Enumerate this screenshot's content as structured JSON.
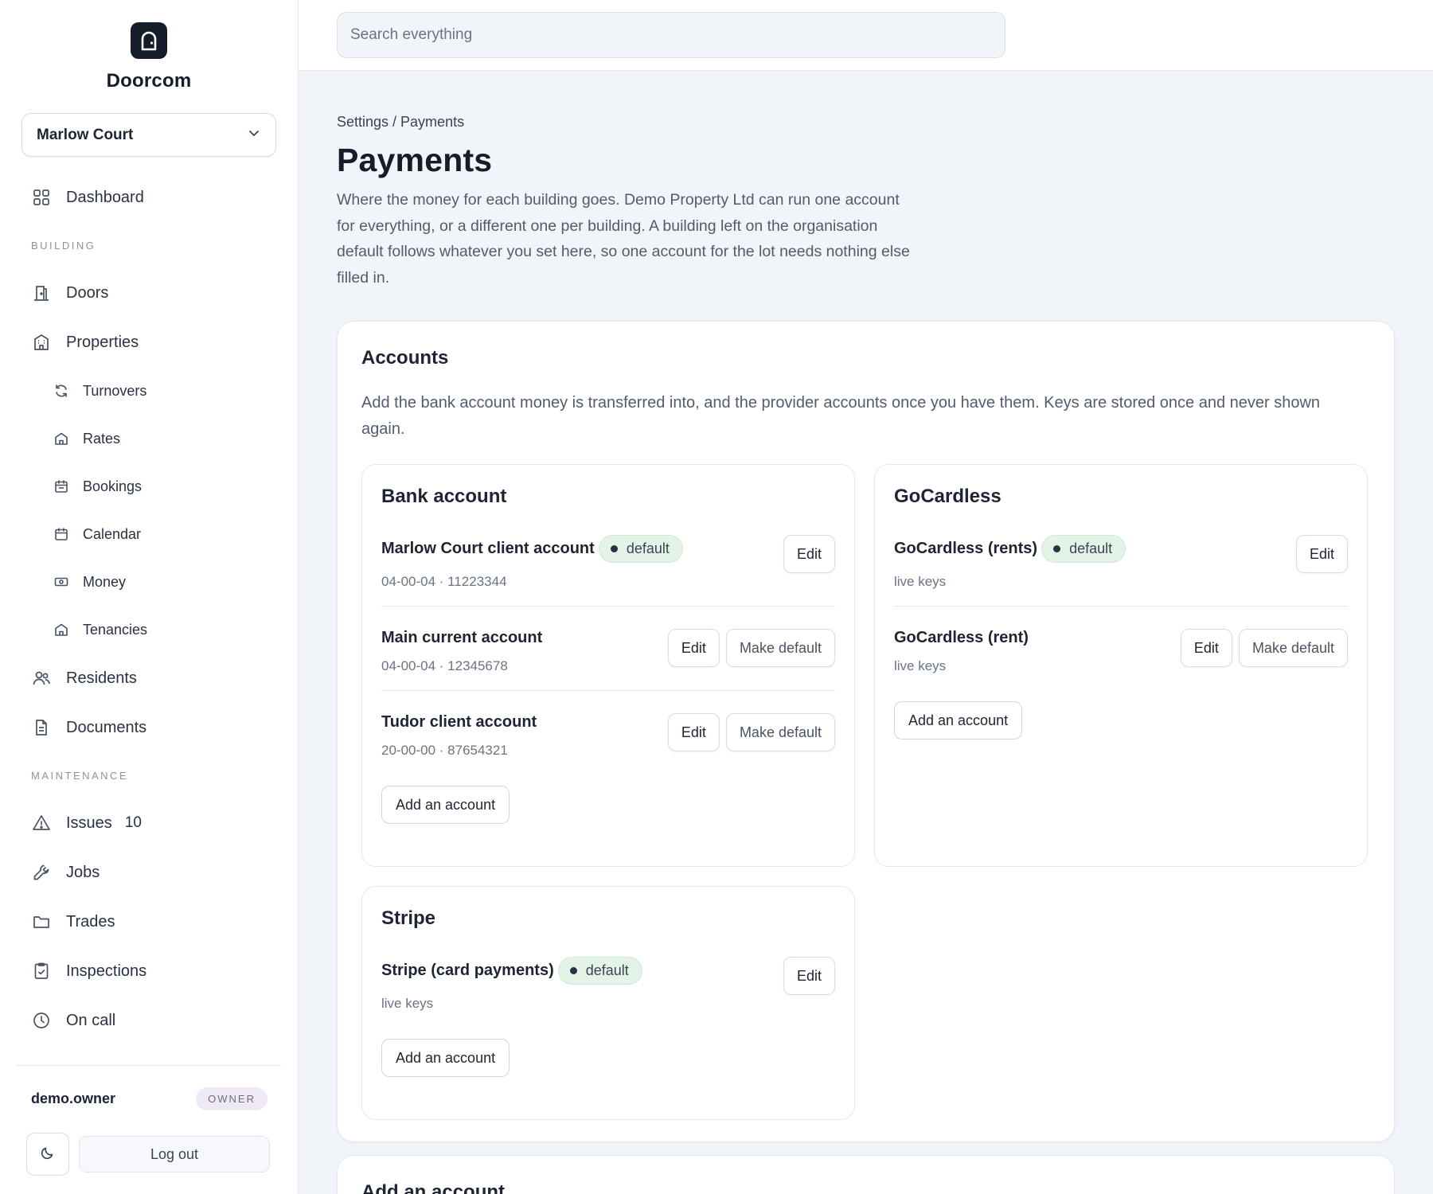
{
  "brand": {
    "name": "Doorcom"
  },
  "building_select": {
    "value": "Marlow Court"
  },
  "nav": {
    "dashboard": "Dashboard",
    "section_building": "BUILDING",
    "doors": "Doors",
    "properties": "Properties",
    "turnovers": "Turnovers",
    "rates": "Rates",
    "bookings": "Bookings",
    "calendar": "Calendar",
    "money": "Money",
    "tenancies": "Tenancies",
    "residents": "Residents",
    "documents": "Documents",
    "section_maintenance": "MAINTENANCE",
    "issues": "Issues",
    "issues_count": "10",
    "jobs": "Jobs",
    "trades": "Trades",
    "inspections": "Inspections",
    "on_call": "On call"
  },
  "user": {
    "name": "demo.owner",
    "role": "OWNER",
    "logout": "Log out"
  },
  "search": {
    "placeholder": "Search everything"
  },
  "page": {
    "breadcrumb": "Settings / Payments",
    "title": "Payments",
    "description": "Where the money for each building goes. Demo Property Ltd can run one account for everything, or a different one per building. A building left on the organisation default follows whatever you set here, so one account for the lot needs nothing else filled in."
  },
  "accounts_card": {
    "title": "Accounts",
    "description": "Add the bank account money is transferred into, and the provider accounts once you have them. Keys are stored once and never shown again."
  },
  "labels": {
    "default": "default",
    "edit": "Edit",
    "make_default": "Make default",
    "add_account": "Add an account"
  },
  "bank": {
    "title": "Bank account",
    "accounts": [
      {
        "name": "Marlow Court client account",
        "meta": "04-00-04 · 11223344",
        "is_default": true
      },
      {
        "name": "Main current account",
        "meta": "04-00-04 · 12345678",
        "is_default": false
      },
      {
        "name": "Tudor client account",
        "meta": "20-00-00 · 87654321",
        "is_default": false
      }
    ]
  },
  "gocardless": {
    "title": "GoCardless",
    "accounts": [
      {
        "name": "GoCardless (rents)",
        "meta": "live keys",
        "is_default": true
      },
      {
        "name": "GoCardless (rent)",
        "meta": "live keys",
        "is_default": false
      }
    ]
  },
  "stripe": {
    "title": "Stripe",
    "accounts": [
      {
        "name": "Stripe (card payments)",
        "meta": "live keys",
        "is_default": true
      }
    ]
  },
  "add_account_card": {
    "title": "Add an account"
  },
  "colors": {
    "accent_dark": "#151c2a",
    "default_badge_bg": "#e4f3e8",
    "role_badge_bg": "#efe9f7",
    "page_bg": "#f1f4f9"
  }
}
